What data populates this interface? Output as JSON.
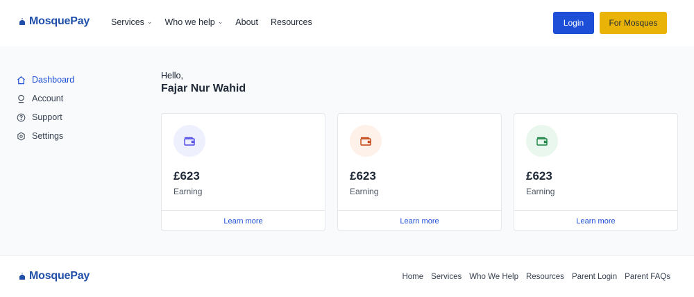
{
  "brand": {
    "name": "MosquePay",
    "color": "#1f4fa8"
  },
  "header": {
    "nav": [
      {
        "label": "Services",
        "dropdown": true
      },
      {
        "label": "Who we help",
        "dropdown": true
      },
      {
        "label": "About",
        "dropdown": false
      },
      {
        "label": "Resources",
        "dropdown": false
      }
    ],
    "login_label": "Login",
    "mosques_label": "For Mosques"
  },
  "sidebar": {
    "items": [
      {
        "label": "Dashboard",
        "icon": "home-icon",
        "active": true
      },
      {
        "label": "Account",
        "icon": "user-icon",
        "active": false
      },
      {
        "label": "Support",
        "icon": "help-circle-icon",
        "active": false
      },
      {
        "label": "Settings",
        "icon": "settings-icon",
        "active": false
      }
    ]
  },
  "greeting": {
    "hello": "Hello,",
    "name": "Fajar Nur Wahid"
  },
  "cards": [
    {
      "amount": "£623",
      "label": "Earning",
      "link": "Learn more",
      "icon": "wallet-icon",
      "icon_color": "#4f46e5",
      "badge_bg": "#eef0fd"
    },
    {
      "amount": "£623",
      "label": "Earning",
      "link": "Learn more",
      "icon": "wallet-icon",
      "icon_color": "#c2410c",
      "badge_bg": "#fdf1ea"
    },
    {
      "amount": "£623",
      "label": "Earning",
      "link": "Learn more",
      "icon": "wallet-icon",
      "icon_color": "#15803d",
      "badge_bg": "#eaf7ef"
    }
  ],
  "footer": {
    "links": [
      "Home",
      "Services",
      "Who We Help",
      "Resources",
      "Parent Login",
      "Parent FAQs"
    ]
  },
  "colors": {
    "primary": "#1d4ed8",
    "accent": "#eab308",
    "background": "#f8fafc"
  }
}
